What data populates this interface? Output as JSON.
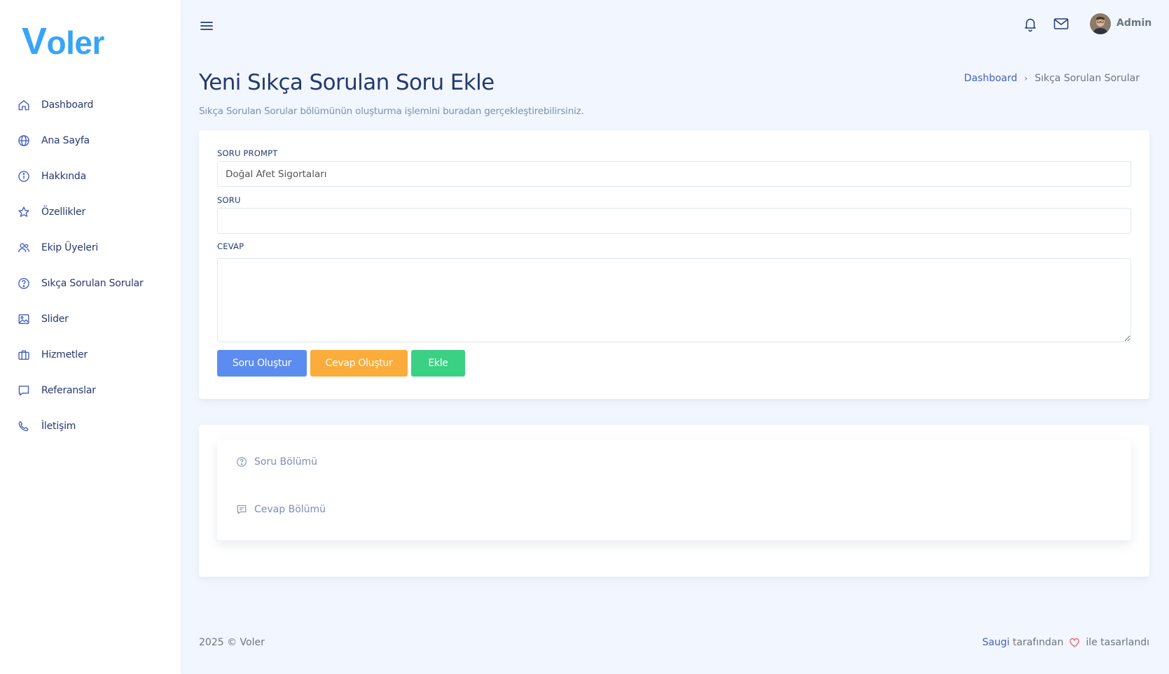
{
  "brand": {
    "logo_first": "V",
    "logo_rest": "oler"
  },
  "sidebar": {
    "items": [
      {
        "label": "Dashboard",
        "icon": "house-icon"
      },
      {
        "label": "Ana Sayfa",
        "icon": "globe-icon"
      },
      {
        "label": "Hakkında",
        "icon": "info-circle-icon"
      },
      {
        "label": "Özellikler",
        "icon": "star-icon"
      },
      {
        "label": "Ekip Üyeleri",
        "icon": "people-icon"
      },
      {
        "label": "Sıkça Sorulan Sorular",
        "icon": "question-circle-icon"
      },
      {
        "label": "Slider",
        "icon": "image-icon"
      },
      {
        "label": "Hizmetler",
        "icon": "briefcase-icon"
      },
      {
        "label": "Referanslar",
        "icon": "chat-square-icon"
      },
      {
        "label": "İletişim",
        "icon": "telephone-icon"
      }
    ]
  },
  "topbar": {
    "user_name": "Admin"
  },
  "page": {
    "title": "Yeni Sıkça Sorulan Soru Ekle",
    "subtitle": "Sıkça Sorulan Sorular bölümünün oluşturma işlemini buradan gerçekleştirebilirsiniz."
  },
  "breadcrumb": {
    "home": "Dashboard",
    "current": "Sıkça Sorulan Sorular"
  },
  "form": {
    "prompt_label": "SORU PROMPT",
    "prompt_value": "Doğal Afet Sigortaları",
    "question_label": "SORU",
    "question_value": "",
    "answer_label": "CEVAP",
    "answer_value": "",
    "btn_generate_question": "Soru Oluştur",
    "btn_generate_answer": "Cevap Oluştur",
    "btn_add": "Ekle"
  },
  "preview": {
    "question_section": "Soru Bölümü",
    "answer_section": "Cevap Bölümü"
  },
  "footer": {
    "copyright": "2025 © Voler",
    "author": "Saugi",
    "by": "tarafından",
    "designed": "ile tasarlandı"
  },
  "colors": {
    "primary": "#435ebe",
    "btn_primary": "#5d8cf0",
    "btn_warning": "#fbac3a",
    "btn_success": "#3ad185",
    "background": "#f2f7ff",
    "heart": "#f3616d"
  }
}
